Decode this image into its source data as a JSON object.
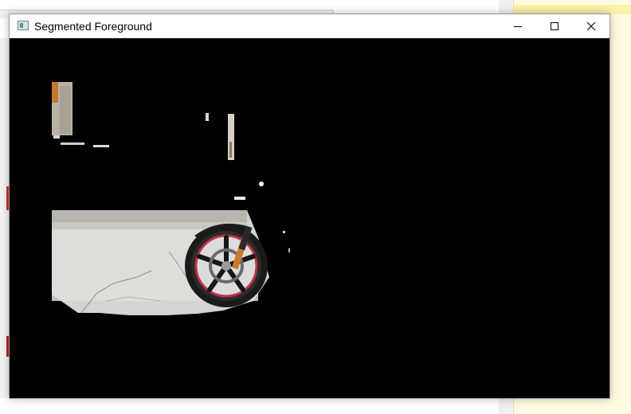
{
  "window": {
    "title": "Segmented Foreground",
    "icon": "image-window-icon",
    "controls": [
      "minimize-icon",
      "maximize-icon",
      "close-icon"
    ]
  },
  "image": {
    "description_key": "segmented-foreground-image",
    "background": "#000000"
  },
  "colors": {
    "titlebar": "#ffffff",
    "segmentation_background": "#000000",
    "notepad_background": "#fffbe3"
  }
}
